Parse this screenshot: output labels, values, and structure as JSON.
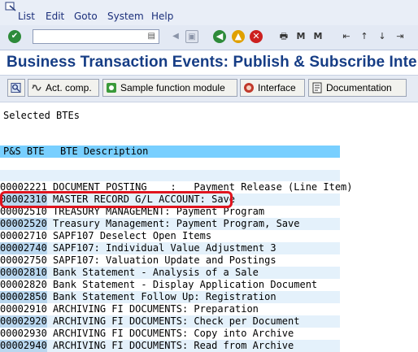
{
  "menu": {
    "items": [
      "List",
      "Edit",
      "Goto",
      "System",
      "Help"
    ]
  },
  "toolbar": {
    "command_value": "",
    "icons": [
      "enter-icon",
      "command-field",
      "back-icon",
      "save-icon",
      "green-back-icon",
      "exit-icon",
      "cancel-icon",
      "print-icon",
      "find-icon",
      "find-next-icon",
      "first-page-icon",
      "previous-page-icon",
      "next-page-icon",
      "last-page-icon"
    ]
  },
  "title": "Business Transaction Events: Publish & Subscribe Inte",
  "appbar": {
    "buttons": [
      {
        "label": "",
        "icon": "info-icon"
      },
      {
        "label": "Act. comp.",
        "icon": "activate-icon"
      },
      {
        "label": "Sample function module",
        "icon": "function-module-icon"
      },
      {
        "label": "Interface",
        "icon": "interface-icon"
      },
      {
        "label": "Documentation",
        "icon": "documentation-icon"
      }
    ]
  },
  "list": {
    "section_label": "Selected BTEs",
    "header": {
      "col1": "P&S BTE",
      "col2": "BTE Description"
    },
    "rows": [
      {
        "code": "00002221",
        "desc": "DOCUMENT POSTING    :   Payment Release (Line Item)"
      },
      {
        "code": "00002310",
        "desc": "MASTER RECORD G/L ACCOUNT: Save"
      },
      {
        "code": "00002510",
        "desc": "TREASURY MANAGEMENT: Payment Program"
      },
      {
        "code": "00002520",
        "desc": "Treasury Management: Payment Program, Save"
      },
      {
        "code": "00002710",
        "desc": "SAPF107 Deselect Open Items"
      },
      {
        "code": "00002740",
        "desc": "SAPF107: Individual Value Adjustment 3"
      },
      {
        "code": "00002750",
        "desc": "SAPF107: Valuation Update and Postings"
      },
      {
        "code": "00002810",
        "desc": "Bank Statement - Analysis of a Sale"
      },
      {
        "code": "00002820",
        "desc": "Bank Statement - Display Application Document"
      },
      {
        "code": "00002850",
        "desc": "Bank Statement Follow Up: Registration"
      },
      {
        "code": "00002910",
        "desc": "ARCHIVING FI DOCUMENTS: Preparation"
      },
      {
        "code": "00002920",
        "desc": "ARCHIVING FI DOCUMENTS: Check per Document"
      },
      {
        "code": "00002930",
        "desc": "ARCHIVING FI DOCUMENTS: Copy into Archive"
      },
      {
        "code": "00002940",
        "desc": "ARCHIVING FI DOCUMENTS: Read from Archive"
      }
    ]
  },
  "colors": {
    "header_bg": "#78cfff",
    "alt_row_bg": "#e4f1fb",
    "code_highlight": "#b9d7ef",
    "annotation_red": "#e0141e",
    "title_blue": "#163d85"
  }
}
